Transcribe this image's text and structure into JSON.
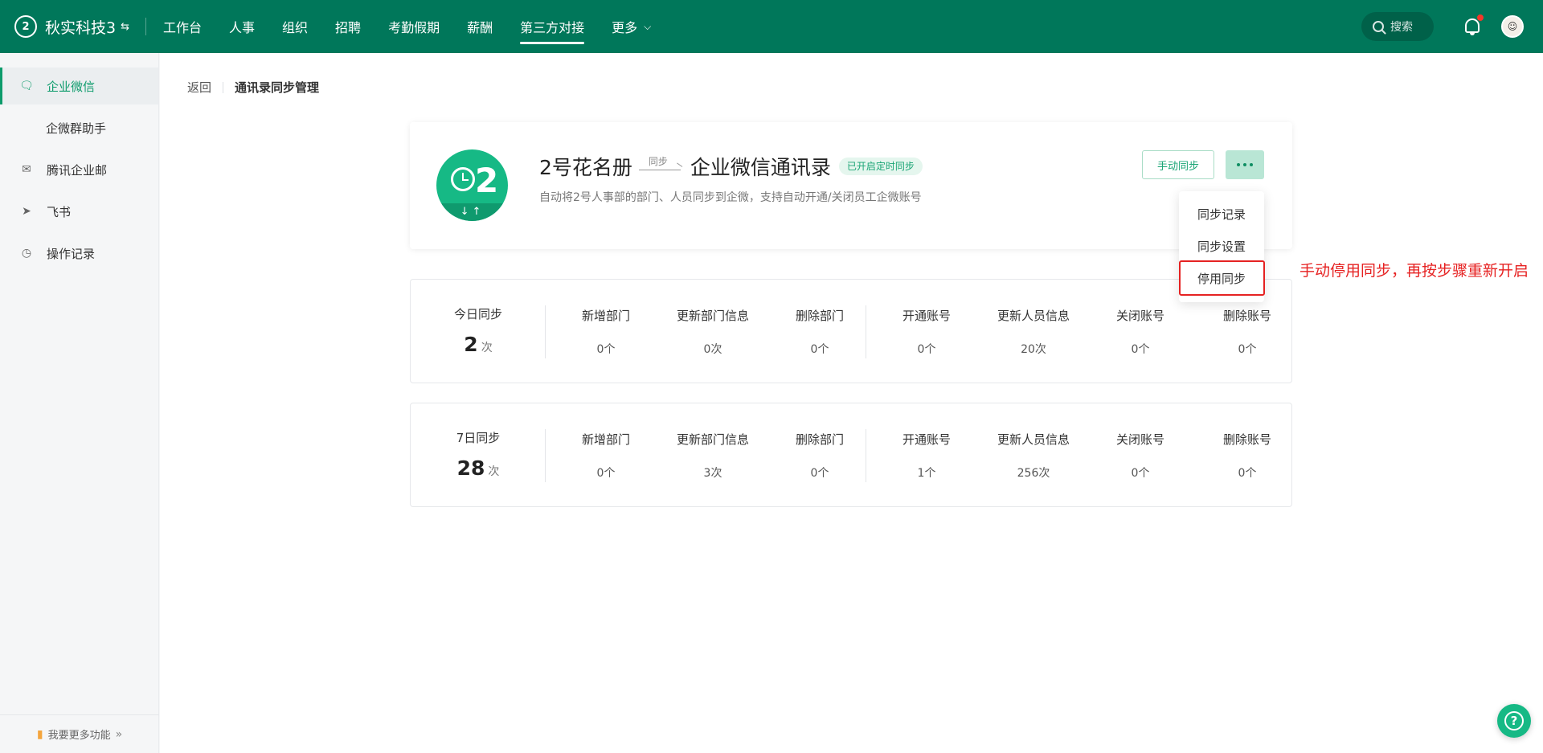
{
  "header": {
    "brand_logo": "2",
    "brand_name": "秋实科技3",
    "switch_icon": "⇆",
    "nav": [
      {
        "label": "工作台"
      },
      {
        "label": "人事"
      },
      {
        "label": "组织"
      },
      {
        "label": "招聘"
      },
      {
        "label": "考勤假期"
      },
      {
        "label": "薪酬"
      },
      {
        "label": "第三方对接",
        "active": true
      },
      {
        "label": "更多"
      }
    ],
    "search_placeholder": "搜索",
    "accent": "#00775a"
  },
  "sidebar": {
    "items": [
      {
        "label": "企业微信",
        "icon": "wechat-work-icon",
        "active": true
      },
      {
        "label": "企微群助手"
      },
      {
        "label": "腾讯企业邮",
        "icon": "mail-icon"
      },
      {
        "label": "飞书",
        "icon": "paper-plane-icon"
      },
      {
        "label": "操作记录",
        "icon": "clock-icon"
      }
    ],
    "bottom_label": "我要更多功能"
  },
  "breadcrumb": {
    "back": "返回",
    "title": "通讯录同步管理"
  },
  "sync_card": {
    "source": "2号花名册",
    "arrow_label": "同步",
    "target": "企业微信通讯录",
    "badge": "已开启定时同步",
    "description": "自动将2号人事部的部门、人员同步到企微，支持自动开通/关闭员工企微账号",
    "manual_button": "手动同步",
    "menu": [
      "同步记录",
      "同步设置",
      "停用同步"
    ]
  },
  "annotation": "手动停用同步，再按步骤重新开启",
  "stats": [
    {
      "label": "今日同步",
      "value": "2",
      "unit": "次",
      "columns": [
        {
          "label": "新增部门",
          "value": "0个"
        },
        {
          "label": "更新部门信息",
          "value": "0次"
        },
        {
          "label": "删除部门",
          "value": "0个"
        },
        {
          "label": "开通账号",
          "value": "0个"
        },
        {
          "label": "更新人员信息",
          "value": "20次"
        },
        {
          "label": "关闭账号",
          "value": "0个"
        },
        {
          "label": "删除账号",
          "value": "0个"
        }
      ]
    },
    {
      "label": "7日同步",
      "value": "28",
      "unit": "次",
      "columns": [
        {
          "label": "新增部门",
          "value": "0个"
        },
        {
          "label": "更新部门信息",
          "value": "3次"
        },
        {
          "label": "删除部门",
          "value": "0个"
        },
        {
          "label": "开通账号",
          "value": "1个"
        },
        {
          "label": "更新人员信息",
          "value": "256次"
        },
        {
          "label": "关闭账号",
          "value": "0个"
        },
        {
          "label": "删除账号",
          "value": "0个"
        }
      ]
    }
  ]
}
